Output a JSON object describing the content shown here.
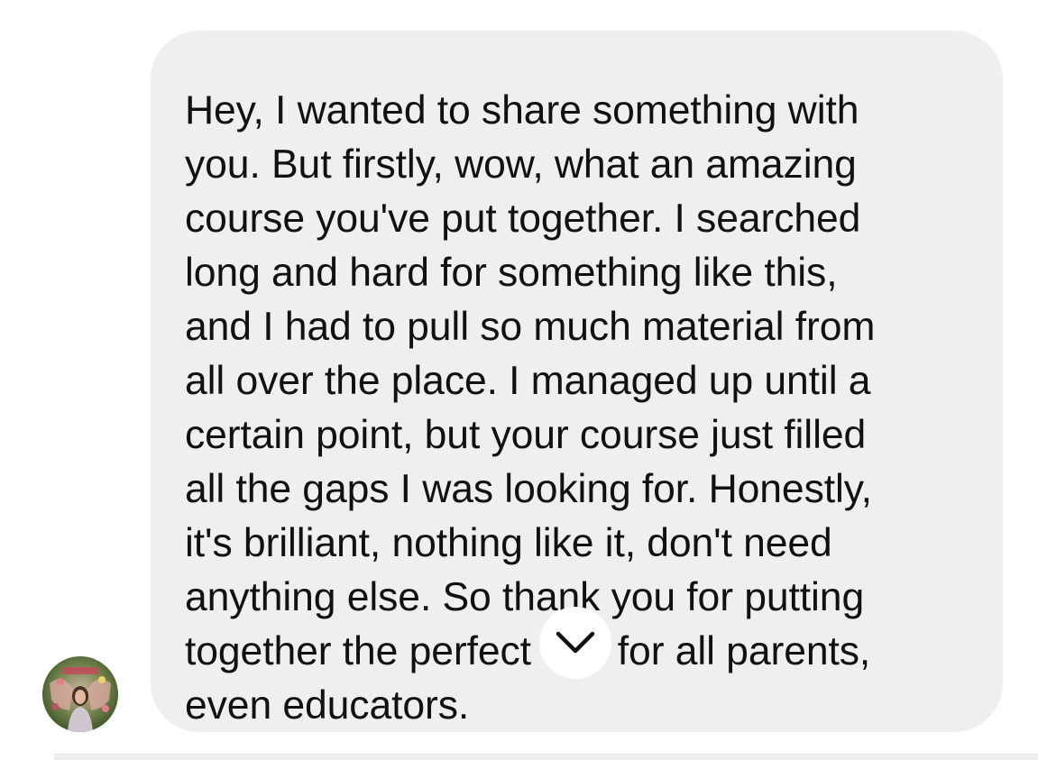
{
  "message": {
    "text": "Hey, I wanted to share something with\nyou. But firstly, wow, what an amazing\ncourse you've put together. I searched\nlong and hard for something like this,\nand I had to pull so much material from\nall over the place. I managed up until a\ncertain point, but your course just filled\nall the gaps I was looking for. Honestly,\nit's brilliant, nothing like it, don't need\nanything else. So thank you for putting\ntogether the perfect tool for all parents,\neven educators."
  },
  "avatar": {
    "icon": "profile-photo-avatar"
  },
  "scroll_button": {
    "icon": "chevron-down-icon"
  },
  "colors": {
    "bubble_background": "#efefef",
    "text": "#111111",
    "page_background": "#ffffff"
  }
}
